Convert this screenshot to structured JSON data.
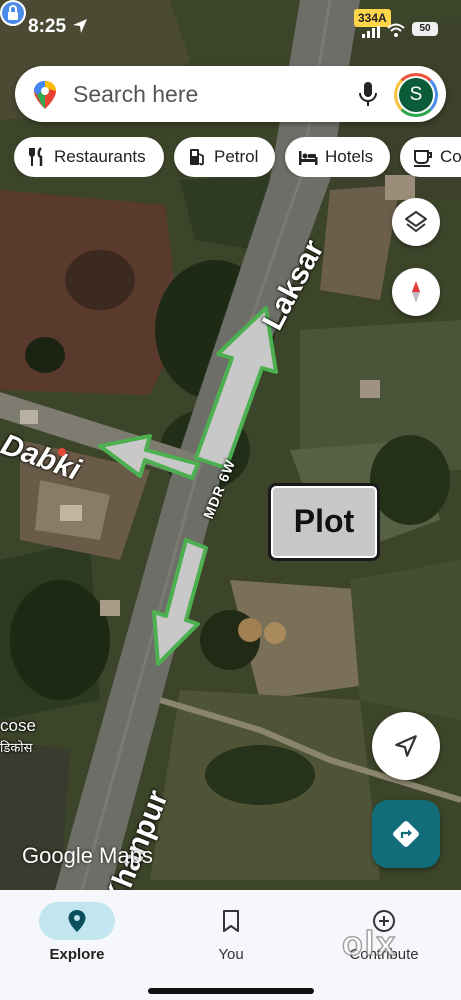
{
  "status_bar": {
    "time": "8:25",
    "carrier_badge": "334A",
    "battery": "50"
  },
  "search": {
    "placeholder": "Search here",
    "avatar_initial": "S"
  },
  "chips": [
    {
      "label": "Restaurants",
      "icon": "fork-knife-icon"
    },
    {
      "label": "Petrol",
      "icon": "fuel-pump-icon"
    },
    {
      "label": "Hotels",
      "icon": "bed-icon"
    },
    {
      "label": "Co",
      "icon": "coffee-cup-icon"
    }
  ],
  "map": {
    "labels": {
      "laksar": "Laksar",
      "dabki": "Dabki",
      "mdr": "MDR 6W",
      "khanpur": "Khanpur",
      "cose": "cose",
      "cose_hindi": "डिकोस",
      "plot": "Plot"
    },
    "watermark": "Google Maps",
    "colors": {
      "arrow_fill": "#c8c8c8",
      "arrow_stroke": "#4caf50",
      "directions_button": "#116d7a",
      "explore_pill": "#c2e6ef"
    }
  },
  "bottom_nav": {
    "items": [
      {
        "label": "Explore",
        "icon": "location-pin-icon",
        "active": true
      },
      {
        "label": "You",
        "icon": "bookmark-icon",
        "active": false
      },
      {
        "label": "Contribute",
        "icon": "add-circle-icon",
        "active": false
      }
    ],
    "overlay_logo": "olx"
  }
}
